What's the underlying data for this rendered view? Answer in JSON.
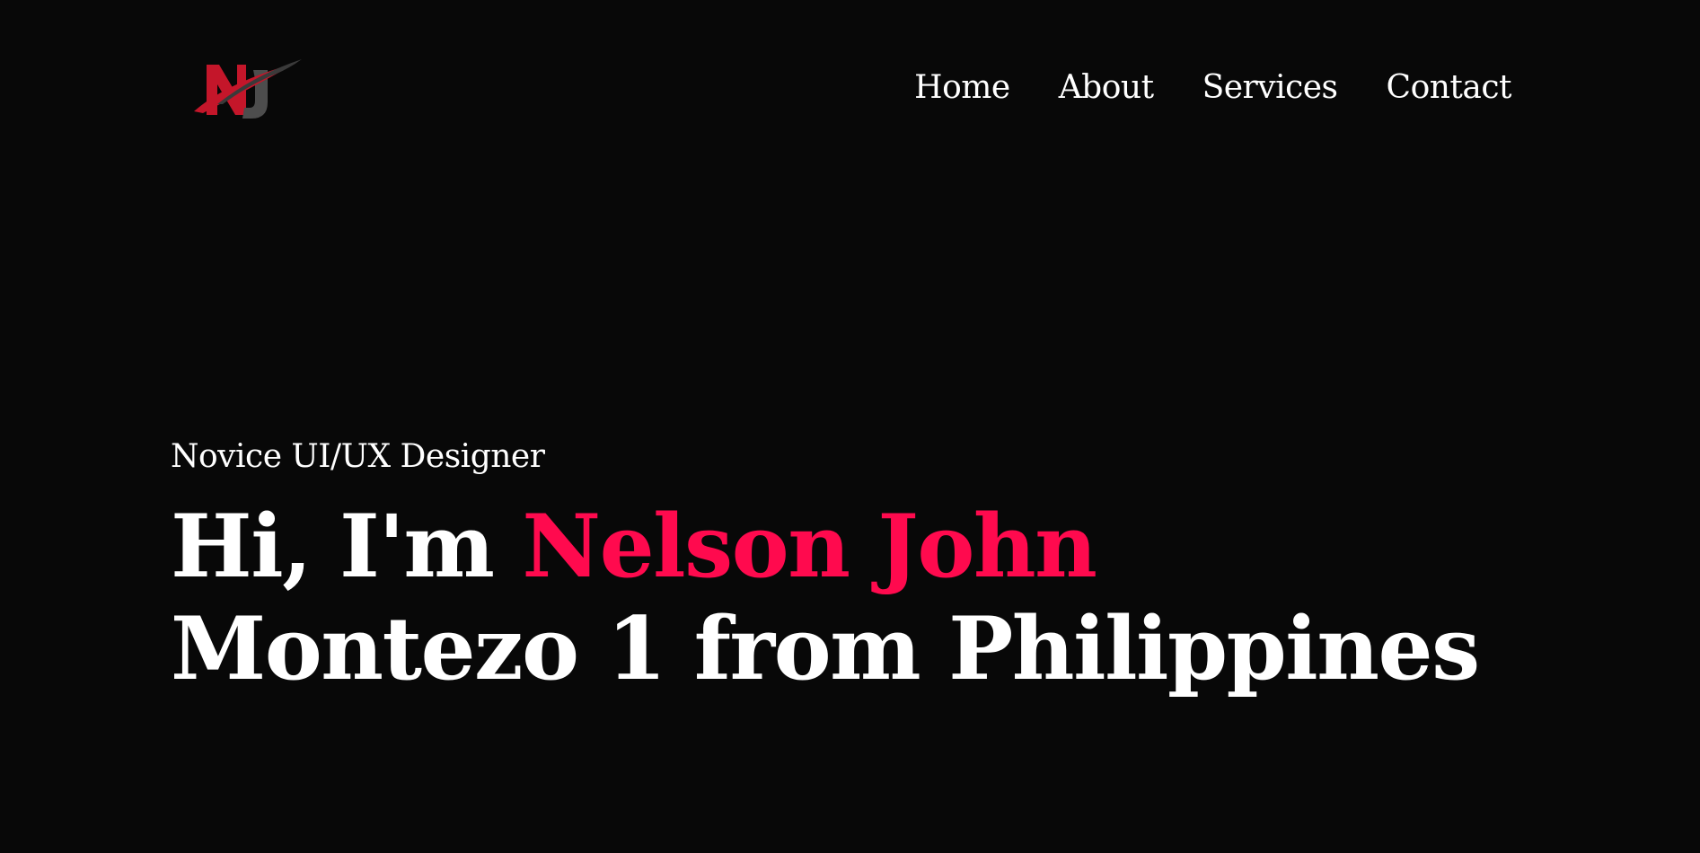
{
  "header": {
    "logo_text": "NJ",
    "logo_colors": {
      "primary": "#c4162a",
      "secondary": "#4a4a4a"
    },
    "nav": [
      {
        "label": "Home"
      },
      {
        "label": "About"
      },
      {
        "label": "Services"
      },
      {
        "label": "Contact"
      }
    ]
  },
  "hero": {
    "subtitle": "Novice UI/UX Designer",
    "greeting": "Hi, I'm",
    "name_highlight": "Nelson John",
    "name_rest": "Montezo 1 from Philippines",
    "accent_color": "#ff0a4e"
  },
  "theme": {
    "background": "#080808",
    "text": "#ffffff"
  }
}
